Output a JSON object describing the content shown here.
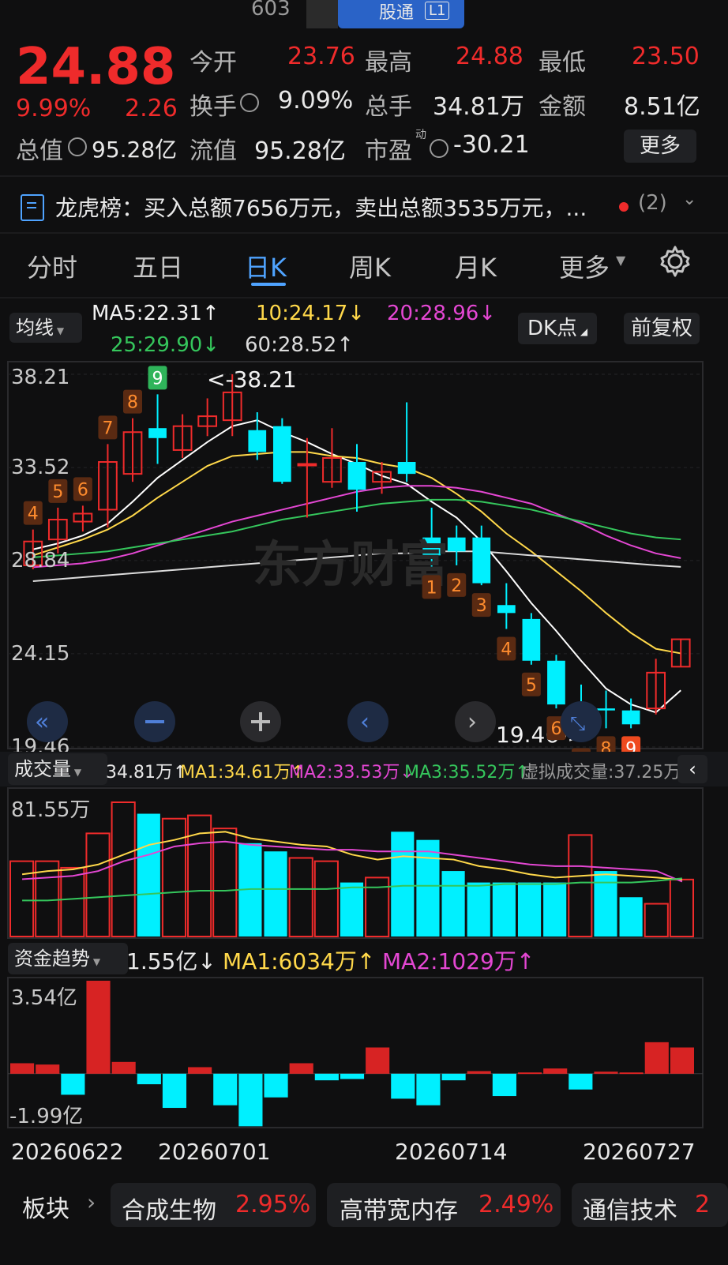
{
  "top": {
    "code": "603",
    "tab_label": "股通",
    "tab_badge": "L1"
  },
  "quote": {
    "price": "24.88",
    "change_pct": "9.99%",
    "change_abs": "2.26",
    "open_label": "今开",
    "open": "23.76",
    "high_label": "最高",
    "high": "24.88",
    "low_label": "最低",
    "low": "23.50",
    "turnover_label": "换手",
    "turnover": "9.09%",
    "vol_label": "总手",
    "vol": "34.81万",
    "amount_label": "金额",
    "amount": "8.51亿",
    "mcap_label": "总值",
    "mcap": "95.28亿",
    "float_label": "流值",
    "float": "95.28亿",
    "pe_label": "市盈",
    "pe_sup": "动",
    "pe": "-30.21",
    "more_label": "更多"
  },
  "notice": {
    "title": "龙虎榜：买入总额7656万元，卖出总额3535万元，...",
    "count": "(2)"
  },
  "tabs": [
    {
      "label": "分时"
    },
    {
      "label": "五日"
    },
    {
      "label": "日K",
      "active": true
    },
    {
      "label": "周K"
    },
    {
      "label": "月K"
    },
    {
      "label": "更多"
    }
  ],
  "ma": {
    "switch_label": "均线",
    "ma5": "MA5:22.31↑",
    "ma10": "10:24.17↓",
    "ma20": "20:28.96↓",
    "ma25": "25:29.90↓",
    "ma60": "60:28.52↑",
    "dk_label": "DK点",
    "adjust_label": "前复权"
  },
  "kline": {
    "price_ticks": [
      "38.21",
      "33.52",
      "28.84",
      "24.15",
      "19.46"
    ],
    "max_note": "<-38.21",
    "min_note": "19.46->",
    "watermark": "东方财富",
    "markers": [
      "4",
      "5",
      "6",
      "7",
      "8",
      "9",
      "1",
      "2",
      "3",
      "4",
      "5",
      "6",
      "7",
      "8",
      "9"
    ]
  },
  "volume": {
    "title": "成交量",
    "value": "34.81万↑",
    "ma1": "MA1:34.61万↑",
    "ma2": "MA2:33.53万↓",
    "ma3": "MA3:35.52万↑",
    "virtual": "虚拟成交量:37.25万",
    "max_tick": "81.55万"
  },
  "fund": {
    "title": "资金趋势",
    "value": "1.55亿↓",
    "ma1": "MA1:6034万↑",
    "ma2": "MA2:1029万↑",
    "top_tick": "3.54亿",
    "bottom_tick": "-1.99亿"
  },
  "dates": [
    "20260622",
    "20260701",
    "20260714",
    "20260727"
  ],
  "sectors": {
    "label": "板块",
    "items": [
      {
        "name": "合成生物",
        "pct": "2.95%"
      },
      {
        "name": "高带宽内存",
        "pct": "2.49%"
      },
      {
        "name": "通信技术",
        "pct": "2"
      }
    ]
  },
  "colors": {
    "up": "#ef2b2b",
    "down": "#00f0ff",
    "ma5": "#ffffff",
    "ma10": "#ffd84a",
    "ma20": "#e447d3",
    "ma25": "#35c65c",
    "ma60": "#dcdcdc"
  },
  "chart_data": [
    {
      "type": "candlestick",
      "title": "",
      "ylim": [
        19.46,
        38.21
      ],
      "y_ticks": [
        38.21,
        33.52,
        28.84,
        24.15,
        19.46
      ],
      "annotations": [
        "<-38.21",
        "19.46->"
      ],
      "candles": [
        {
          "o": 28.6,
          "c": 29.8,
          "h": 30.4,
          "l": 28.4
        },
        {
          "o": 29.9,
          "c": 30.9,
          "h": 31.5,
          "l": 29.2
        },
        {
          "o": 30.8,
          "c": 31.2,
          "h": 31.6,
          "l": 30.3
        },
        {
          "o": 31.4,
          "c": 33.8,
          "h": 34.7,
          "l": 30.5
        },
        {
          "o": 33.2,
          "c": 35.3,
          "h": 36.0,
          "l": 32.8
        },
        {
          "o": 35.5,
          "c": 35.0,
          "h": 37.2,
          "l": 33.7
        },
        {
          "o": 34.4,
          "c": 35.6,
          "h": 36.2,
          "l": 34.0
        },
        {
          "o": 35.6,
          "c": 36.1,
          "h": 37.0,
          "l": 35.1
        },
        {
          "o": 35.9,
          "c": 37.3,
          "h": 38.21,
          "l": 35.1
        },
        {
          "o": 35.4,
          "c": 34.3,
          "h": 36.3,
          "l": 33.9
        },
        {
          "o": 35.6,
          "c": 32.8,
          "h": 36.0,
          "l": 32.7
        },
        {
          "o": 33.7,
          "c": 33.7,
          "h": 35.0,
          "l": 31.0
        },
        {
          "o": 32.8,
          "c": 34.0,
          "h": 35.5,
          "l": 32.5
        },
        {
          "o": 33.8,
          "c": 32.4,
          "h": 34.7,
          "l": 31.3
        },
        {
          "o": 32.8,
          "c": 33.3,
          "h": 33.8,
          "l": 32.2
        },
        {
          "o": 33.8,
          "c": 33.2,
          "h": 36.8,
          "l": 32.8
        },
        {
          "o": 30.0,
          "c": 29.1,
          "h": 31.5,
          "l": 28.5
        },
        {
          "o": 30.0,
          "c": 29.3,
          "h": 30.6,
          "l": 28.6
        },
        {
          "o": 30.0,
          "c": 27.7,
          "h": 30.6,
          "l": 27.6
        },
        {
          "o": 26.6,
          "c": 26.2,
          "h": 27.7,
          "l": 25.4
        },
        {
          "o": 25.9,
          "c": 23.8,
          "h": 26.2,
          "l": 23.6
        },
        {
          "o": 23.8,
          "c": 21.6,
          "h": 24.1,
          "l": 21.4
        },
        {
          "o": 21.6,
          "c": 20.3,
          "h": 22.6,
          "l": 19.8
        },
        {
          "o": 21.4,
          "c": 21.3,
          "h": 22.3,
          "l": 20.4
        },
        {
          "o": 21.3,
          "c": 20.6,
          "h": 21.9,
          "l": 20.4
        },
        {
          "o": 21.4,
          "c": 23.2,
          "h": 23.9,
          "l": 21.1
        },
        {
          "o": 23.5,
          "c": 24.88,
          "h": 24.88,
          "l": 23.5
        }
      ],
      "ma_lines": {
        "MA5": [
          29.4,
          29.7,
          30.1,
          30.7,
          31.8,
          33.0,
          33.9,
          34.8,
          35.6,
          35.9,
          35.3,
          34.8,
          34.2,
          33.7,
          33.1,
          32.7,
          31.8,
          31.0,
          29.8,
          28.3,
          26.7,
          25.3,
          23.8,
          22.4,
          21.6,
          21.2,
          22.31
        ],
        "MA10": [
          29.1,
          29.5,
          29.9,
          30.4,
          31.1,
          32.0,
          32.8,
          33.6,
          34.1,
          34.2,
          34.3,
          34.3,
          34.1,
          34.0,
          33.7,
          33.5,
          33.0,
          32.2,
          31.3,
          30.2,
          29.3,
          28.3,
          27.3,
          26.2,
          25.2,
          24.4,
          24.17
        ],
        "MA20": [
          28.5,
          28.6,
          28.7,
          28.9,
          29.2,
          29.6,
          30.0,
          30.4,
          30.8,
          31.1,
          31.4,
          31.7,
          32.0,
          32.3,
          32.5,
          32.6,
          32.6,
          32.5,
          32.3,
          32.0,
          31.7,
          31.2,
          30.7,
          30.1,
          29.6,
          29.2,
          28.96
        ],
        "MA25": [
          29.0,
          29.1,
          29.2,
          29.3,
          29.5,
          29.7,
          29.9,
          30.1,
          30.3,
          30.6,
          30.9,
          31.1,
          31.3,
          31.5,
          31.7,
          31.8,
          31.9,
          31.9,
          31.8,
          31.6,
          31.4,
          31.1,
          30.8,
          30.5,
          30.2,
          30.0,
          29.9
        ],
        "MA60": [
          27.8,
          27.9,
          28.0,
          28.1,
          28.2,
          28.3,
          28.4,
          28.5,
          28.6,
          28.7,
          28.8,
          28.9,
          29.0,
          29.1,
          29.2,
          29.2,
          29.3,
          29.3,
          29.3,
          29.2,
          29.1,
          29.0,
          28.9,
          28.8,
          28.7,
          28.6,
          28.52
        ]
      }
    },
    {
      "type": "bar",
      "title": "成交量",
      "y_max_label": "81.55万",
      "values": [
        46,
        46,
        42,
        63,
        82,
        75,
        72,
        74,
        66,
        57,
        52,
        48,
        46,
        33,
        36,
        64,
        59,
        40,
        33,
        33,
        33,
        33,
        62,
        40,
        24,
        20,
        34.81
      ],
      "colors": [
        "up",
        "up",
        "up",
        "up",
        "up",
        "down",
        "up",
        "up",
        "up",
        "down",
        "down",
        "up",
        "up",
        "down",
        "up",
        "down",
        "down",
        "down",
        "down",
        "down",
        "down",
        "down",
        "up",
        "down",
        "down",
        "up",
        "up"
      ],
      "ma": {
        "MA1": [
          38,
          40,
          41,
          44,
          50,
          56,
          59,
          63,
          64,
          60,
          58,
          56,
          55,
          50,
          47,
          49,
          48,
          47,
          43,
          41,
          38,
          36,
          37,
          38,
          37,
          36,
          34.61
        ],
        "MA2": [
          35,
          36,
          37,
          40,
          46,
          50,
          55,
          57,
          58,
          56,
          55,
          54,
          53,
          53,
          52,
          52,
          52,
          50,
          48,
          46,
          44,
          43,
          43,
          42,
          41,
          40,
          33.53
        ],
        "MA3": [
          22,
          22,
          23,
          24,
          25,
          26,
          27,
          28,
          28,
          29,
          29,
          29,
          29,
          30,
          30,
          31,
          31,
          31,
          31,
          32,
          32,
          32,
          33,
          33,
          33,
          34,
          35.52
        ]
      }
    },
    {
      "type": "bar",
      "title": "资金趋势",
      "y_range": [
        -1.99,
        3.54
      ],
      "values": [
        0.4,
        0.35,
        -0.8,
        3.54,
        0.45,
        -0.4,
        -1.3,
        0.25,
        -1.2,
        -2.0,
        -0.9,
        0.4,
        -0.25,
        -0.2,
        1.0,
        -0.95,
        -1.2,
        -0.25,
        0.1,
        -0.85,
        0.05,
        0.2,
        -0.6,
        0.08,
        0.05,
        1.2,
        1.0
      ]
    }
  ]
}
